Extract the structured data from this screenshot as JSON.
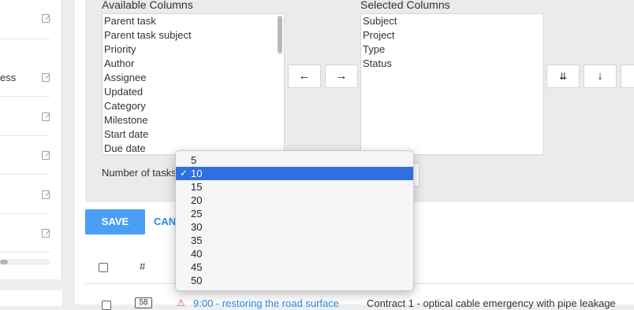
{
  "left_panel": {
    "visible_label": "ess",
    "edit_icon": "edit-icon"
  },
  "columns": {
    "available_label": "Available Columns",
    "available": [
      "Parent task",
      "Parent task subject",
      "Priority",
      "Author",
      "Assignee",
      "Updated",
      "Category",
      "Milestone",
      "Start date",
      "Due date"
    ],
    "selected_label": "Selected Columns",
    "selected": [
      "Subject",
      "Project",
      "Type",
      "Status"
    ]
  },
  "buttons": {
    "move_left": "←",
    "move_right": "→",
    "move_bottom": "⇊",
    "move_down": "↓"
  },
  "page_size": {
    "label": "Number of tasks",
    "options": [
      "5",
      "10",
      "15",
      "20",
      "25",
      "30",
      "35",
      "40",
      "45",
      "50"
    ],
    "selected": "10",
    "check": "✓"
  },
  "actions": {
    "save": "SAVE",
    "cancel": "CANCEL"
  },
  "table": {
    "hash_header": "#",
    "row": {
      "number": "58",
      "warning_icon": "⚠",
      "link": "9:00 - restoring the road surface",
      "description": "Contract 1 - optical cable emergency with pipe leakage"
    }
  },
  "colors": {
    "accent": "#4a9ff5",
    "link": "#2b8ae8",
    "selection": "#2f6fe0",
    "warning": "#e04545"
  }
}
